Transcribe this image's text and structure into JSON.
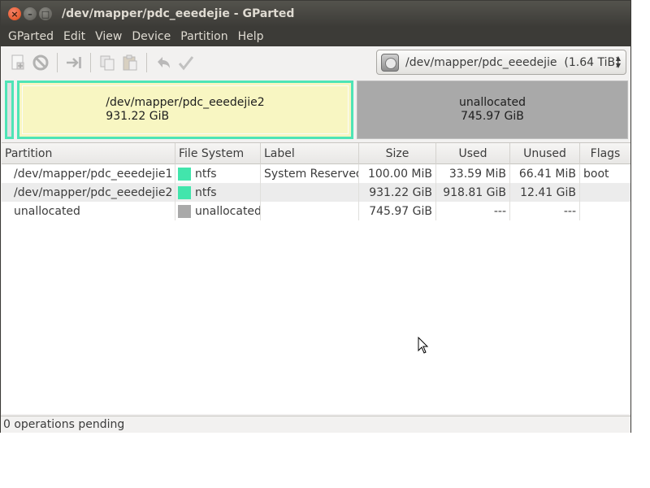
{
  "window": {
    "title": "/dev/mapper/pdc_eeedejie - GParted",
    "buttons": [
      "close-icon",
      "minimize-icon",
      "maximize-icon"
    ]
  },
  "menubar": {
    "items": [
      "GParted",
      "Edit",
      "View",
      "Device",
      "Partition",
      "Help"
    ]
  },
  "toolbar": {
    "icons": [
      "new-partition-icon",
      "delete-icon",
      "resize-move-icon",
      "copy-icon",
      "paste-icon",
      "undo-icon",
      "apply-icon"
    ],
    "device_selector": {
      "device": "/dev/mapper/pdc_eeedejie",
      "size": "(1.64 TiB)"
    }
  },
  "partition_map": {
    "segments": [
      {
        "name": "",
        "size": ""
      },
      {
        "name": "/dev/mapper/pdc_eeedejie2",
        "size": "931.22 GiB"
      },
      {
        "name": "unallocated",
        "size": "745.97 GiB"
      }
    ]
  },
  "table": {
    "columns": [
      "Partition",
      "File System",
      "Label",
      "Size",
      "Used",
      "Unused",
      "Flags"
    ],
    "rows": [
      {
        "partition": "/dev/mapper/pdc_eeedejie1",
        "fs": "ntfs",
        "fs_color": "#42e5ac",
        "label": "System Reserved",
        "size": "100.00 MiB",
        "used": "33.59 MiB",
        "unused": "66.41 MiB",
        "flags": "boot"
      },
      {
        "partition": "/dev/mapper/pdc_eeedejie2",
        "fs": "ntfs",
        "fs_color": "#42e5ac",
        "label": "",
        "size": "931.22 GiB",
        "used": "918.81 GiB",
        "unused": "12.41 GiB",
        "flags": ""
      },
      {
        "partition": "unallocated",
        "fs": "unallocated",
        "fs_color": "#a9a9a9",
        "label": "",
        "size": "745.97 GiB",
        "used": "---",
        "unused": "---",
        "flags": ""
      }
    ]
  },
  "status": {
    "text": "0 operations pending"
  },
  "colors": {
    "ntfs": "#42e5ac",
    "unallocated": "#a9a9a9",
    "selected_border": "#4ee4b6",
    "partition_fill": "#f8f6c2"
  }
}
